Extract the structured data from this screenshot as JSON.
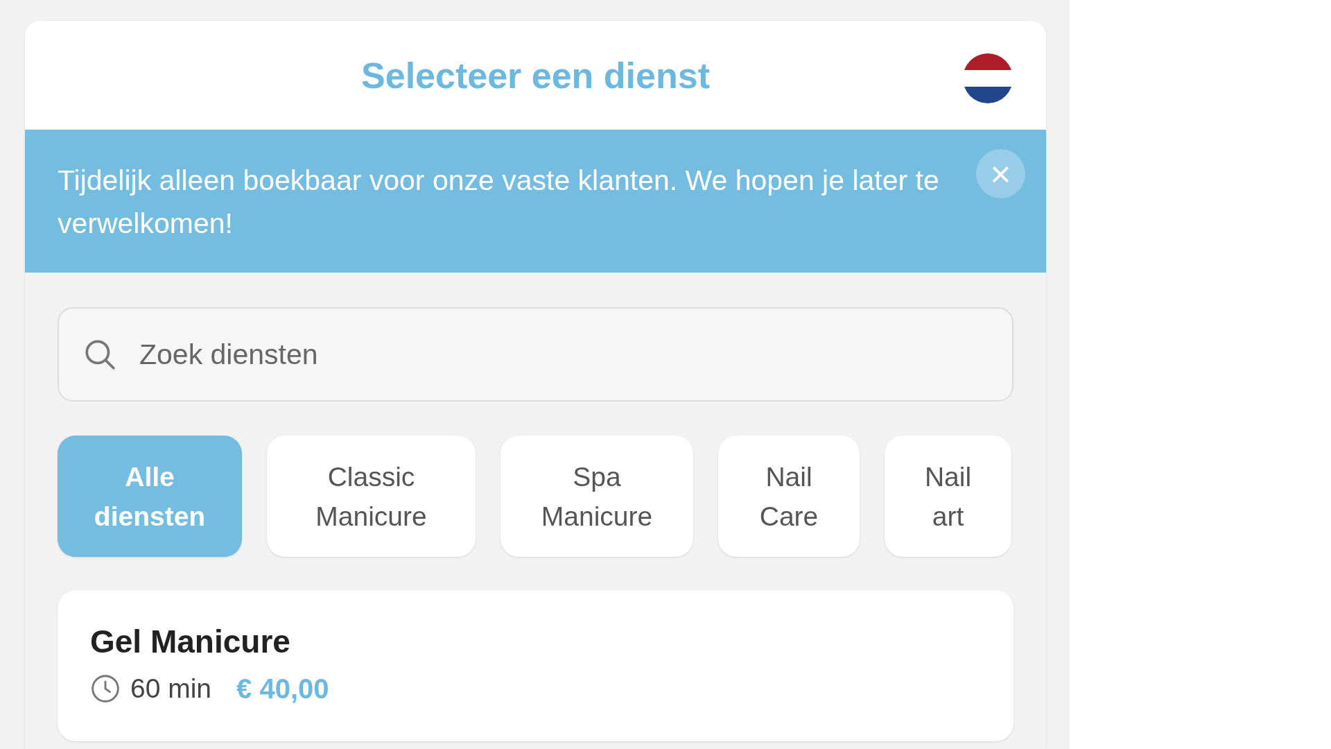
{
  "header": {
    "title": "Selecteer een dienst"
  },
  "notice": {
    "text": "Tijdelijk alleen boekbaar voor onze vaste klanten. We hopen je later te verwelkomen!",
    "close": "×"
  },
  "search": {
    "placeholder": "Zoek diensten"
  },
  "categories": [
    {
      "label": "Alle diensten",
      "selected": true
    },
    {
      "label": "Classic Manicure",
      "selected": false
    },
    {
      "label": "Spa Manicure",
      "selected": false
    },
    {
      "label": "Nail Care",
      "selected": false
    },
    {
      "label": "Nail art",
      "selected": false
    }
  ],
  "services": [
    {
      "name": "Gel Manicure",
      "duration": "60 min",
      "price": "€ 40,00"
    }
  ]
}
